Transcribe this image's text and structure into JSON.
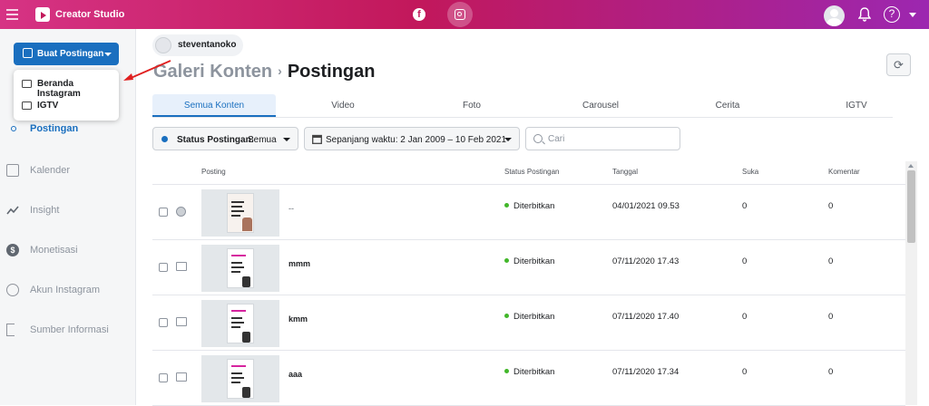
{
  "topbar": {
    "app_title": "Creator Studio",
    "fb_glyph": "f",
    "help_glyph": "?"
  },
  "colors": {
    "topbar_start": "#d63384",
    "topbar_end": "#9c27b0",
    "primary": "#1a6fbf",
    "published": "#42b72a",
    "annotation_arrow": "#e02020"
  },
  "sidebar": {
    "create_button": "Buat Postingan",
    "dropdown": [
      {
        "label": "Beranda Instagram",
        "icon": "feed-icon"
      },
      {
        "label": "IGTV",
        "icon": "tv-icon"
      }
    ],
    "items": [
      {
        "label": "Postingan",
        "icon": "circle-icon",
        "active": true
      },
      {
        "label": "Kalender",
        "icon": "calendar-icon"
      },
      {
        "label": "Insight",
        "icon": "insight-icon"
      },
      {
        "label": "Monetisasi",
        "icon": "coin-icon"
      },
      {
        "label": "Akun Instagram",
        "icon": "account-icon"
      },
      {
        "label": "Sumber Informasi",
        "icon": "exit-icon"
      }
    ]
  },
  "header": {
    "username": "steventanoko",
    "breadcrumb_parent": "Galeri Konten",
    "breadcrumb_sep": "›",
    "breadcrumb_current": "Postingan",
    "refresh_glyph": "⟳"
  },
  "tabs": [
    "Semua Konten",
    "Video",
    "Foto",
    "Carousel",
    "Cerita",
    "IGTV"
  ],
  "filters": {
    "status_label": "Status Postingan:",
    "status_value": "Semua",
    "date_range": "Sepanjang waktu: 2 Jan 2009 – 10 Feb 2021",
    "search_placeholder": "Cari"
  },
  "table": {
    "columns": [
      "Posting",
      "Status Postingan",
      "Tanggal",
      "Suka",
      "Komentar"
    ],
    "rows": [
      {
        "title": "--",
        "type": "photo-icon",
        "thumb": "COPYWRITING",
        "status": "Diterbitkan",
        "date": "04/01/2021 09.53",
        "likes": "0",
        "comments": "0"
      },
      {
        "title": "mmm",
        "type": "video-icon",
        "thumb": "IG LIVE",
        "status": "Diterbitkan",
        "date": "07/11/2020 17.43",
        "likes": "0",
        "comments": "0"
      },
      {
        "title": "kmm",
        "type": "video-icon",
        "thumb": "IG LIVE",
        "status": "Diterbitkan",
        "date": "07/11/2020 17.40",
        "likes": "0",
        "comments": "0"
      },
      {
        "title": "aaa",
        "type": "video-icon",
        "thumb": "IG LIVE",
        "status": "Diterbitkan",
        "date": "07/11/2020 17.34",
        "likes": "0",
        "comments": "0"
      }
    ]
  }
}
